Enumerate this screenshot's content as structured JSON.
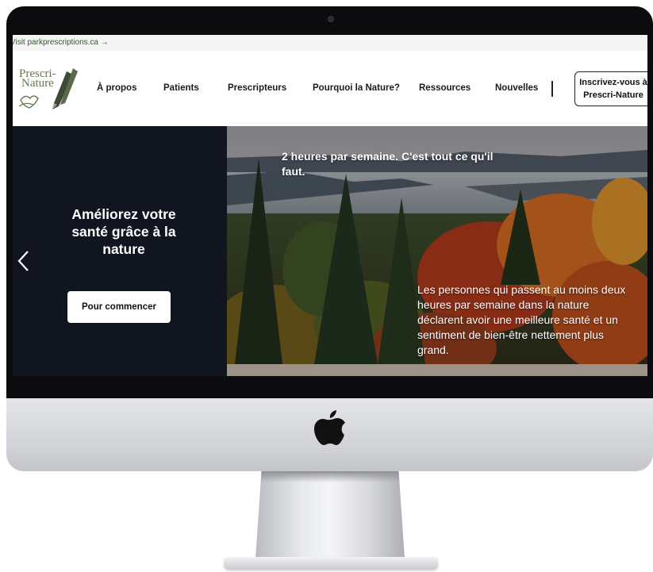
{
  "topbar": {
    "link_text": "Visit parkprescriptions.ca →"
  },
  "logo": {
    "line1": "Prescri-",
    "line2": "Nature"
  },
  "nav": {
    "items": [
      "À propos",
      "Patients",
      "Prescripteurs",
      "Pourquoi la Nature?",
      "Ressources",
      "Nouvelles"
    ],
    "cta": "Inscrivez-vous à Prescri-Nature"
  },
  "hero": {
    "heading": "Améliorez votre santé grâce à la nature",
    "button": "Pour commencer",
    "prev_icon": "chevron-left-icon",
    "caption": "2 heures par semaine. C'est tout ce qu'il faut.",
    "body": "Les personnes qui passent au moins deux heures par semaine dans la nature déclarent avoir une meilleure santé et un sentiment de bien-être nettement plus grand."
  },
  "colors": {
    "hero_panel": "#111520",
    "brand_green": "#667a52",
    "topbar_link": "#2f5a2c"
  }
}
